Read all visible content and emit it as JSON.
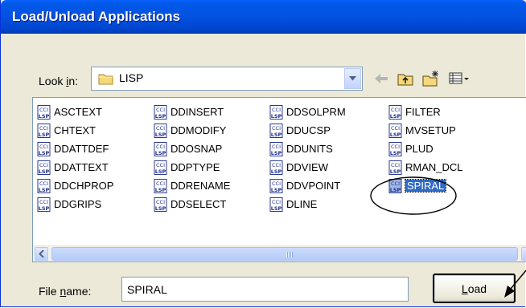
{
  "window": {
    "title": "Load/Unload Applications"
  },
  "lookin": {
    "label_before": "Look ",
    "label_underlined": "i",
    "label_after": "n:",
    "value": "LISP"
  },
  "toolbar": {
    "back_icon": "back-arrow-icon",
    "up_icon": "up-folder-icon",
    "new_folder_icon": "new-folder-icon",
    "views_icon": "views-menu-icon"
  },
  "files": {
    "columns": [
      [
        "ASCTEXT",
        "CHTEXT",
        "DDATTDEF",
        "DDATTEXT",
        "DDCHPROP",
        "DDGRIPS"
      ],
      [
        "DDINSERT",
        "DDMODIFY",
        "DDOSNAP",
        "DDPTYPE",
        "DDRENAME",
        "DDSELECT"
      ],
      [
        "DDSOLPRM",
        "DDUCSP",
        "DDUNITS",
        "DDVIEW",
        "DDVPOINT",
        "DLINE"
      ],
      [
        "FILTER",
        "MVSETUP",
        "PLUD",
        "RMAN_DCL",
        "SPIRAL"
      ]
    ],
    "selected": "SPIRAL",
    "icon": "lsp-file-icon"
  },
  "filename": {
    "label_before": "File ",
    "label_underlined": "n",
    "label_after": "ame:",
    "value": "SPIRAL"
  },
  "load_button": {
    "label_underlined": "L",
    "label_after": "oad"
  },
  "colors": {
    "title_bar": "#0054e3",
    "selection": "#316ac5",
    "dialog_bg": "#ece9d8"
  }
}
